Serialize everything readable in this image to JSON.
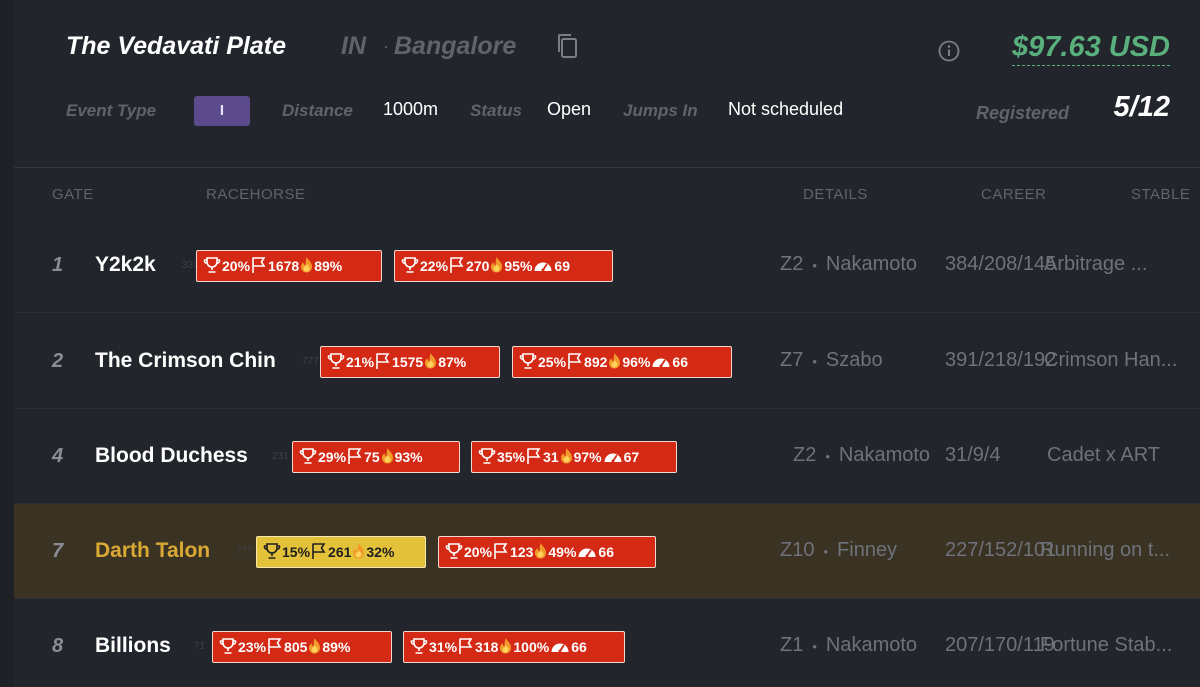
{
  "race": {
    "title": "The Vedavati Plate",
    "country": "IN",
    "separator": "·",
    "city": "Bangalore",
    "price": "$97.63 USD",
    "event_type_label": "Event Type",
    "event_type_value": "I",
    "distance_label": "Distance",
    "distance_value": "1000m",
    "status_label": "Status",
    "status_value": "Open",
    "jumps_label": "Jumps In",
    "jumps_value": "Not scheduled",
    "registered_label": "Registered",
    "registered_value": "5/12"
  },
  "columns": {
    "gate": "GATE",
    "racehorse": "RACEHORSE",
    "details": "DETAILS",
    "career": "CAREER",
    "stable": "STABLE"
  },
  "rows": [
    {
      "gate": "1",
      "name": "Y2k2k",
      "ghost": "331",
      "s1": {
        "win": "20%",
        "races": "1678",
        "fire": "89%"
      },
      "s2": {
        "win": "22%",
        "races": "270",
        "fire": "95%",
        "speed": "69"
      },
      "zone": "Z2",
      "bloodline": "Nakamoto",
      "career": "384/208/145",
      "stable": "Arbitrage ..."
    },
    {
      "gate": "2",
      "name": "The Crimson Chin",
      "ghost": "777",
      "s1": {
        "win": "21%",
        "races": "1575",
        "fire": "87%"
      },
      "s2": {
        "win": "25%",
        "races": "892",
        "fire": "96%",
        "speed": "66"
      },
      "zone": "Z7",
      "bloodline": "Szabo",
      "career": "391/218/192",
      "stable": "Crimson Han..."
    },
    {
      "gate": "4",
      "name": "Blood Duchess",
      "ghost": "231",
      "s1": {
        "win": "29%",
        "races": "75",
        "fire": "93%"
      },
      "s2": {
        "win": "35%",
        "races": "31",
        "fire": "97%",
        "speed": "67"
      },
      "zone": "Z2",
      "bloodline": "Nakamoto",
      "career": "31/9/4",
      "stable": "Cadet x ART"
    },
    {
      "gate": "7",
      "name": "Darth Talon",
      "ghost": "777",
      "s1": {
        "win": "15%",
        "races": "261",
        "fire": "32%"
      },
      "s2": {
        "win": "20%",
        "races": "123",
        "fire": "49%",
        "speed": "66"
      },
      "zone": "Z10",
      "bloodline": "Finney",
      "career": "227/152/101",
      "stable": "Running on t..."
    },
    {
      "gate": "8",
      "name": "Billions",
      "ghost": "71",
      "s1": {
        "win": "23%",
        "races": "805",
        "fire": "89%"
      },
      "s2": {
        "win": "31%",
        "races": "318",
        "fire": "100%",
        "speed": "66"
      },
      "zone": "Z1",
      "bloodline": "Nakamoto",
      "career": "207/170/119",
      "stable": "Fortune Stab..."
    }
  ],
  "colors": {
    "accent_green": "#5ab07c",
    "stat_red": "#d42a15",
    "stat_gold": "#e3c23a",
    "highlight_row": "#3a3223",
    "highlight_name": "#d9a934"
  }
}
